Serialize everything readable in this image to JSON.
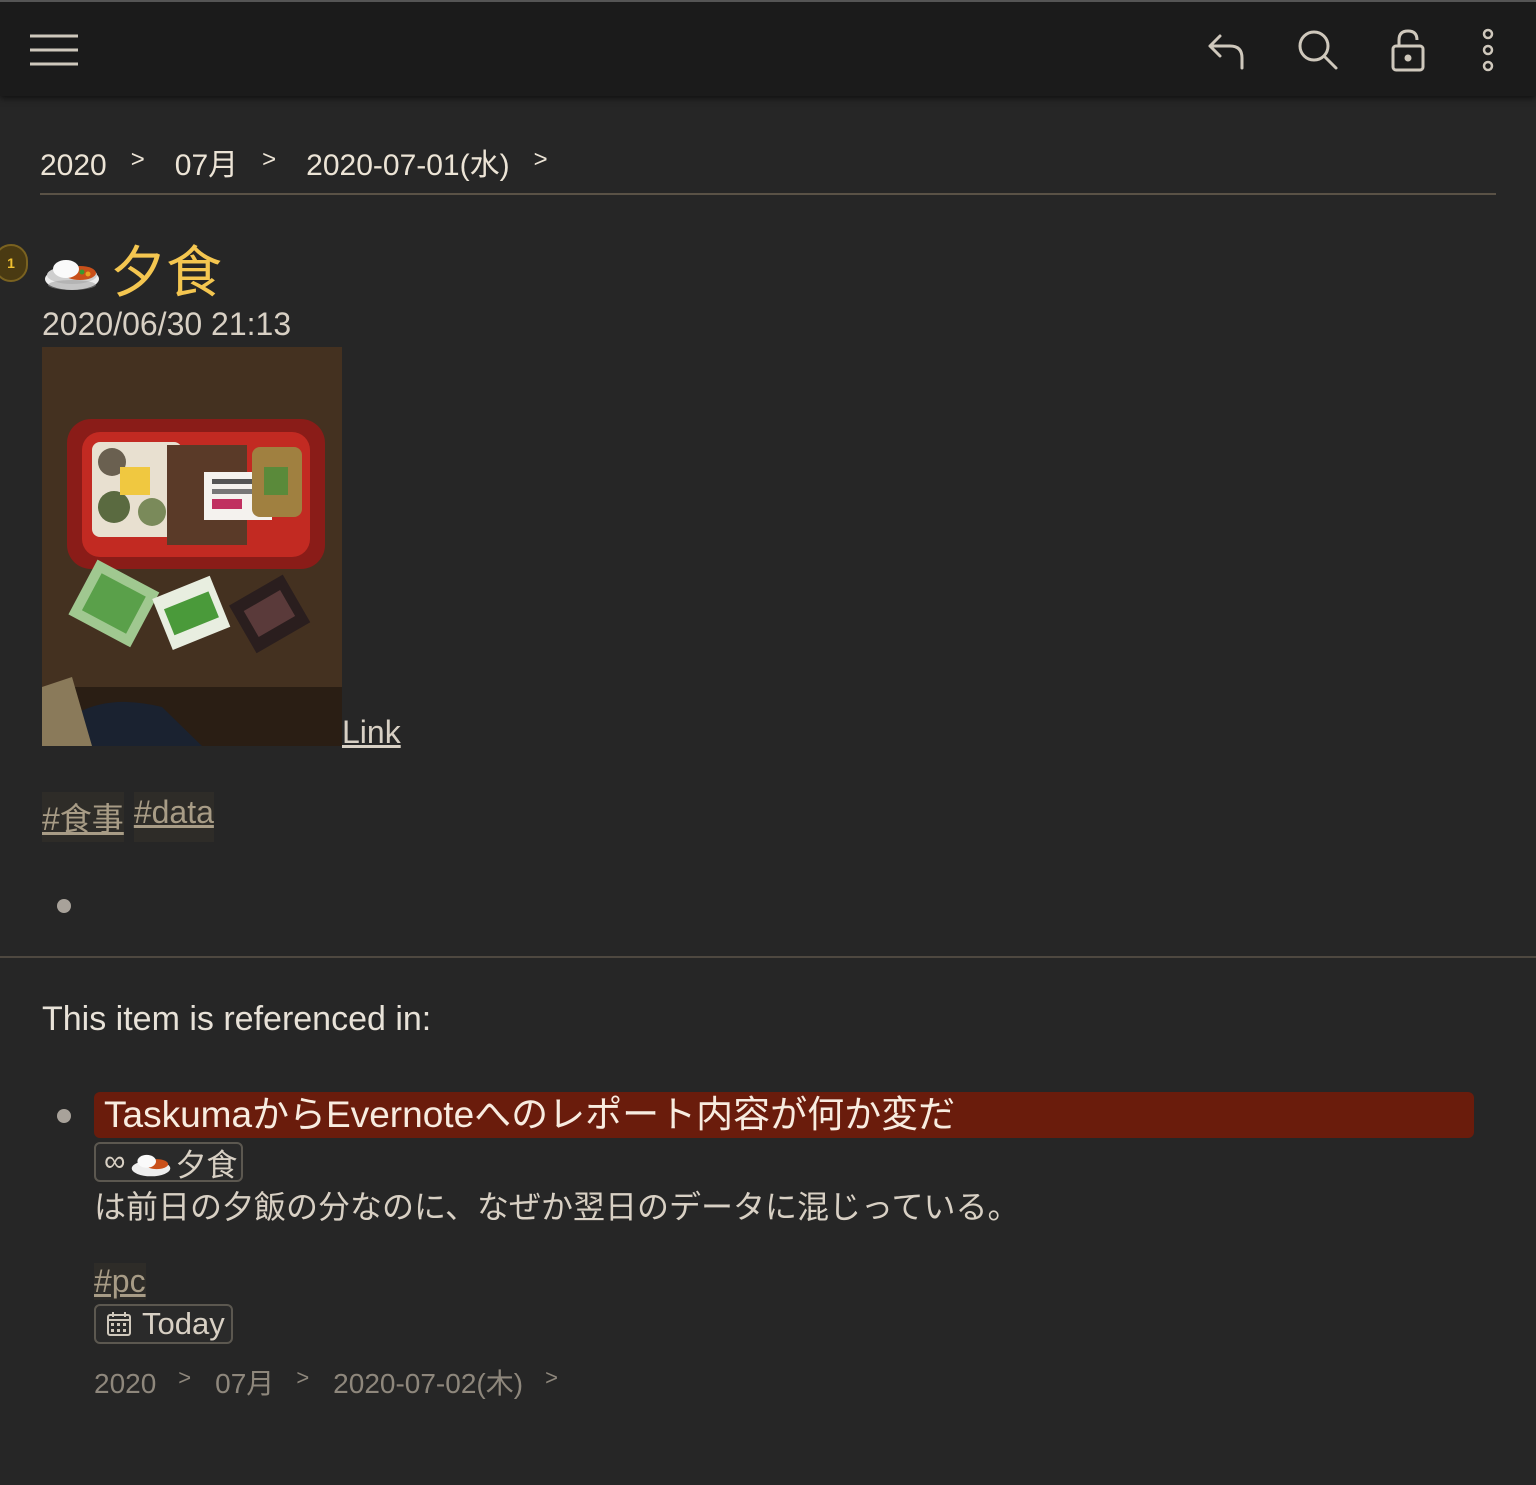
{
  "toolbar": {
    "menu_icon": "hamburger-menu-icon",
    "back_icon": "undo-arrow-icon",
    "search_icon": "search-icon",
    "lock_icon": "lock-icon",
    "more_icon": "more-vertical-icon"
  },
  "breadcrumb": {
    "items": [
      "2020",
      "07月",
      "2020-07-01(水)"
    ],
    "separator": ">"
  },
  "item": {
    "badge": "1",
    "title": "夕食",
    "title_emoji": "curry-rice-icon",
    "timestamp": "2020/06/30 21:13",
    "link_label": "Link",
    "tags": [
      "#食事",
      "#data"
    ]
  },
  "references": {
    "heading": "This item is referenced in:",
    "entries": [
      {
        "title": "TaskumaからEvernoteへのレポート内容が何か変だ",
        "chip_symbol": "∞",
        "chip_label": "夕食",
        "body": "は前日の夕飯の分なのに、なぜか翌日のデータに混じっている。",
        "tag": "#pc",
        "date_chip": "Today",
        "breadcrumb": [
          "2020",
          "07月",
          "2020-07-02(木)"
        ]
      }
    ]
  },
  "colors": {
    "background": "#262626",
    "title": "#f4c650",
    "reference_highlight": "#6a1c0c"
  }
}
